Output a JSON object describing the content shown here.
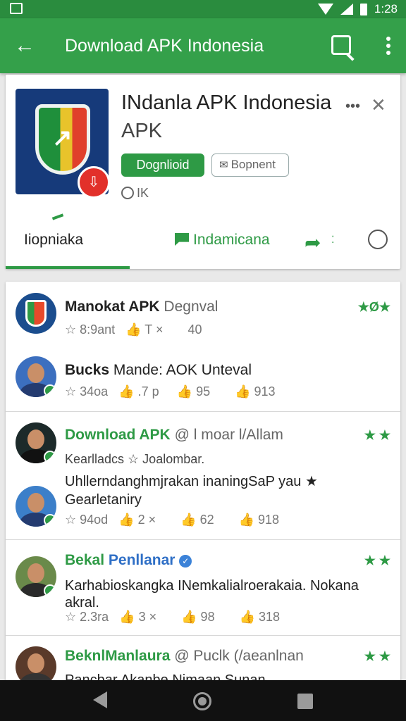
{
  "status_bar": {
    "time": "1:28"
  },
  "app_bar": {
    "title": "Download APK Indonesia"
  },
  "app": {
    "name": "INdanla APK Indonesia",
    "subtitle": "APK",
    "download_label": "Dognlioid",
    "bookmark_label": "Bopnent",
    "meta": "IK"
  },
  "tabs": [
    {
      "label": "Iiopniaka"
    },
    {
      "label": "Indamicana"
    }
  ],
  "posts": [
    {
      "name_bold": "Manokat APK",
      "name_light": "Degnval",
      "stars": "★Ø★",
      "stats": [
        "☆ 8:9ant",
        "👍 T ×",
        "40"
      ]
    },
    {
      "name_bold": "Bucks",
      "name_light": "Mande: AOK Unteval",
      "stats": [
        "☆ 34oa",
        "👍 .7 p",
        "👍 95",
        "👍 913"
      ]
    },
    {
      "name_hl": "Download APK",
      "name_light": "@ l moar l/Allam",
      "stars": "★ ★",
      "line1": "Kearlladcs ☆ Joalombar.",
      "line2": "Uhllerndanghmjrakan inaningSaP yau ★",
      "line3": "Gearletaniry",
      "stats": [
        "☆ 94od",
        "👍 2 ×",
        "👍 62",
        "👍 918"
      ]
    },
    {
      "name_hl": "Bekal",
      "name_blue": "Penllanar",
      "stars": "★ ★",
      "line1": "Karhabioskangka INemkalialroerakaia. Nokana",
      "line2": "akral.",
      "stats": [
        "☆ 2.3ra",
        "👍 3 ×",
        "👍 98",
        "👍 318"
      ]
    },
    {
      "name_hl": "BeknlManlaura",
      "name_light": "@ Puclk (/aeanlnan",
      "stars": "★ ★",
      "line1": "Pancbar Akanbe Nimaan Sunan"
    }
  ]
}
